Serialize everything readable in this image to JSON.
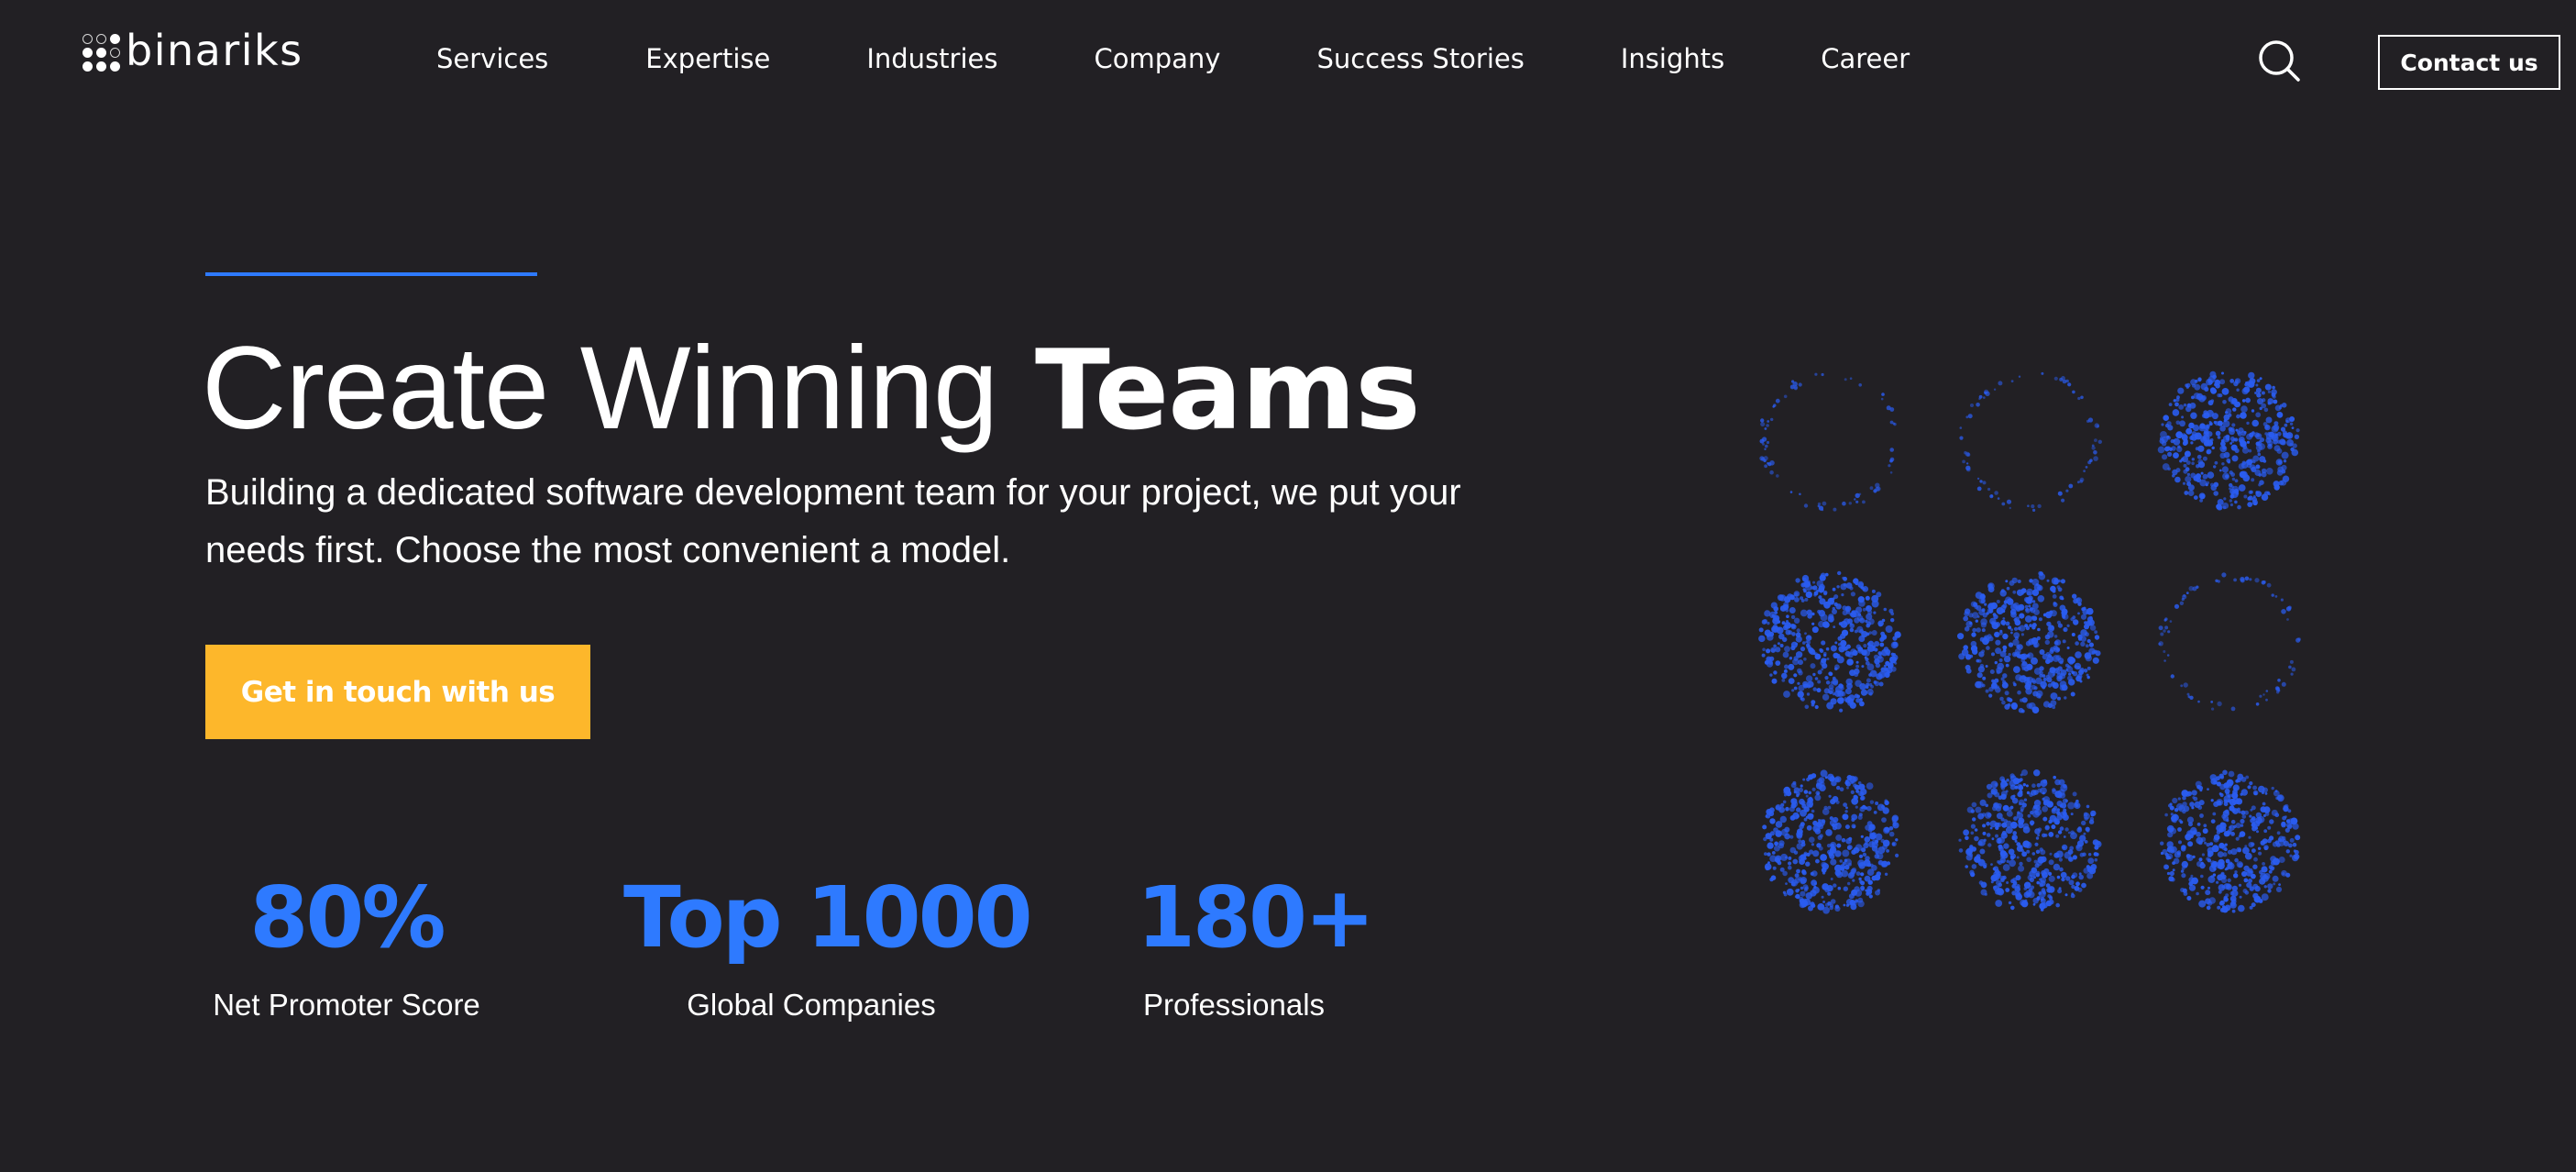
{
  "header": {
    "logo_text": "binariks",
    "nav": [
      {
        "label": "Services"
      },
      {
        "label": "Expertise"
      },
      {
        "label": "Industries"
      },
      {
        "label": "Company"
      },
      {
        "label": "Success Stories"
      },
      {
        "label": "Insights"
      },
      {
        "label": "Career"
      }
    ],
    "search_icon": "search-icon",
    "contact_label": "Contact us"
  },
  "hero": {
    "title_light": "Create Winning",
    "title_bold": "Teams",
    "subtitle": "Building a dedicated software development team for your project, we put your needs first. Choose the most convenient a model.",
    "cta_label": "Get in touch with us"
  },
  "stats": [
    {
      "value": "80%",
      "label": "Net Promoter Score"
    },
    {
      "value": "Top 1000",
      "label": "Global Companies"
    },
    {
      "value": "180+",
      "label": "Professionals"
    }
  ],
  "graphic": {
    "particle_grid": [
      [
        "ring",
        "ring",
        "filled"
      ],
      [
        "filled",
        "filled",
        "ring"
      ],
      [
        "filled",
        "filled",
        "filled"
      ]
    ],
    "particle_color": "#2a5cf0"
  },
  "colors": {
    "background": "#222024",
    "accent_blue": "#2e7aff",
    "cta_yellow": "#fdb72b",
    "text": "#ffffff"
  }
}
